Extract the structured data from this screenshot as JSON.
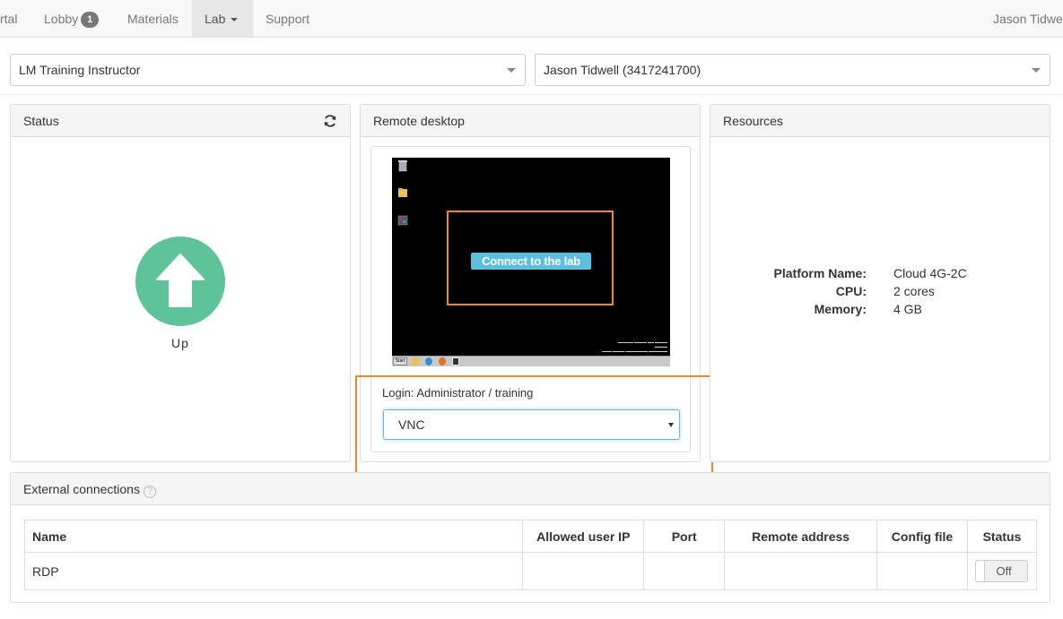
{
  "nav": {
    "portal_label": "rtal",
    "lobby_label": "Lobby",
    "lobby_badge": "1",
    "materials_label": "Materials",
    "lab_label": "Lab",
    "support_label": "Support",
    "user_name": "Jason Tidwe"
  },
  "selectors": {
    "event_value": "LM Training Instructor",
    "student_value": "Jason Tidwell (3417241700)"
  },
  "status_panel": {
    "title": "Status",
    "state_label": "Up",
    "state_color": "#5fc399"
  },
  "remote_desktop": {
    "title": "Remote desktop",
    "connect_label": "Connect to the lab",
    "login_text": "Login: Administrator / training",
    "protocol_value": "VNC",
    "taskbar_start": "Start",
    "highlight_color": "#f0882a"
  },
  "resources": {
    "title": "Resources",
    "items": [
      {
        "label": "Platform Name:",
        "value": "Cloud 4G-2C"
      },
      {
        "label": "CPU:",
        "value": "2 cores"
      },
      {
        "label": "Memory:",
        "value": "4 GB"
      }
    ]
  },
  "external": {
    "title": "External connections",
    "columns": [
      "Name",
      "Allowed user IP",
      "Port",
      "Remote address",
      "Config file",
      "Status"
    ],
    "rows": [
      {
        "name": "RDP",
        "allowed_ip": "",
        "port": "",
        "remote_address": "",
        "config_file": "",
        "status": "Off"
      }
    ]
  }
}
